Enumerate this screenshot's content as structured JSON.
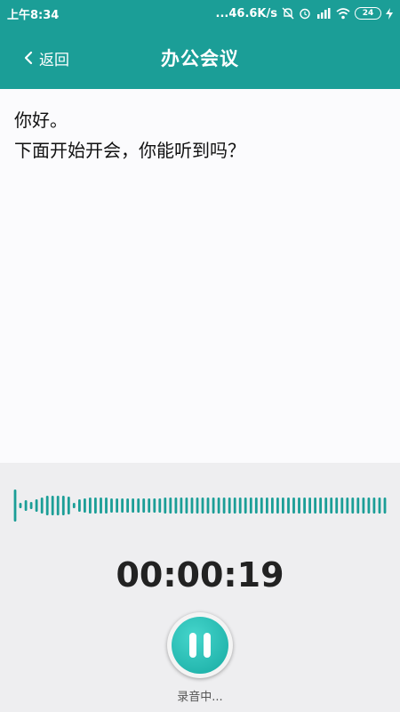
{
  "status_bar": {
    "time": "上午8:34",
    "network_speed": "...46.6K/s",
    "battery": "24",
    "icons": [
      "mute-icon",
      "alarm-icon",
      "hd-signal-icon",
      "wifi-icon",
      "battery-icon",
      "charging-icon"
    ]
  },
  "header": {
    "back_label": "返回",
    "title": "办公会议",
    "color": "#1b9e97"
  },
  "transcript": {
    "lines": [
      "你好。",
      "下面开始开会，你能听到吗？"
    ]
  },
  "recorder": {
    "timer": "00:00:19",
    "status": "录音中...",
    "accent": "#16aaa2",
    "waveform_levels": [
      0.9,
      0.15,
      0.3,
      0.2,
      0.35,
      0.45,
      0.55,
      0.55,
      0.55,
      0.55,
      0.5,
      0.15,
      0.35,
      0.4,
      0.45,
      0.45,
      0.45,
      0.45,
      0.4,
      0.4,
      0.4,
      0.4,
      0.4,
      0.4,
      0.4,
      0.4,
      0.4,
      0.4,
      0.45,
      0.45,
      0.45,
      0.45,
      0.45,
      0.45,
      0.45,
      0.45,
      0.45,
      0.45,
      0.45,
      0.45,
      0.45,
      0.45,
      0.45,
      0.45,
      0.45,
      0.45,
      0.45,
      0.45,
      0.45,
      0.45,
      0.45,
      0.45,
      0.45,
      0.45,
      0.45,
      0.45,
      0.45,
      0.45,
      0.45,
      0.45,
      0.45,
      0.45,
      0.45,
      0.45,
      0.45,
      0.45,
      0.45,
      0.45,
      0.45,
      0.45
    ]
  }
}
